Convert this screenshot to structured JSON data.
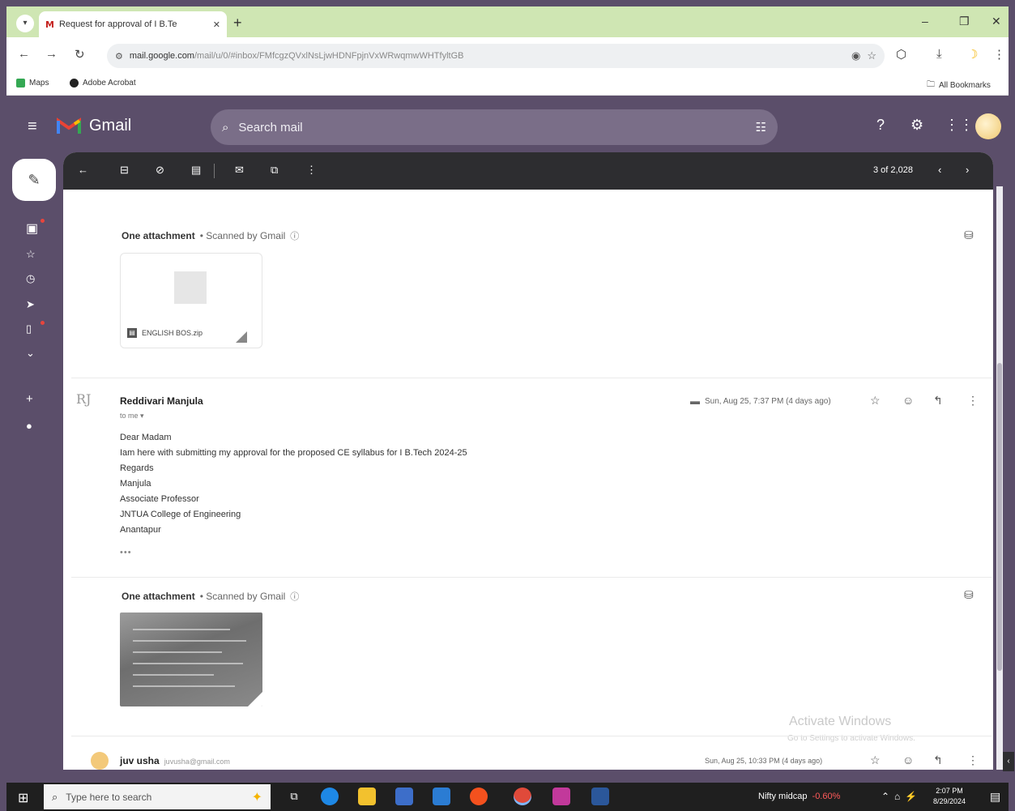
{
  "browser": {
    "tab_title": "Request for approval of I B.Te",
    "tab_favicon": "M",
    "url_host": "mail.google.com",
    "url_rest": "/mail/u/0/#inbox/FMfcgzQVxlNsLjwHDNFpjnVxWRwqmwWHTfyltGB",
    "bookmarks": [
      {
        "label": "Maps",
        "icon": "maps-icon",
        "color": "#34a853"
      },
      {
        "label": "Adobe Acrobat",
        "icon": "acrobat-icon",
        "color": "#222222"
      }
    ],
    "all_bookmarks": "All Bookmarks"
  },
  "gmail": {
    "logo_text": "Gmail",
    "search_placeholder": "Search mail",
    "pager": "3 of 2,028",
    "accent": "#5b4e6a"
  },
  "thread": {
    "first_attachment": {
      "heading": "One attachment",
      "scanned": "• Scanned by Gmail",
      "file_name": "ENGLISH BOS.zip"
    },
    "message": {
      "sender": "Reddivari Manjula",
      "to": "to me",
      "date": "Sun, Aug 25, 7:37 PM (4 days ago)",
      "body": [
        "Dear Madam",
        "Iam here with submitting my approval for the proposed CE syllabus for I B.Tech 2024-25",
        "Regards",
        "Manjula",
        "Associate Professor",
        "JNTUA College of Engineering",
        "Anantapur"
      ],
      "trimmed": "•••"
    },
    "second_attachment": {
      "heading": "One attachment",
      "scanned": "• Scanned by Gmail"
    },
    "next": {
      "sender": "juv usha",
      "address": "juvusha@gmail.com",
      "date": "Sun, Aug 25, 10:33 PM (4 days ago)"
    }
  },
  "watermark": {
    "title": "Activate Windows",
    "subtitle": "Go to Settings to activate Windows."
  },
  "taskbar": {
    "search_placeholder": "Type here to search",
    "nifty_label": "Nifty midcap",
    "nifty_change": "-0.60%",
    "time": "2:07 PM",
    "date": "8/29/2024"
  }
}
